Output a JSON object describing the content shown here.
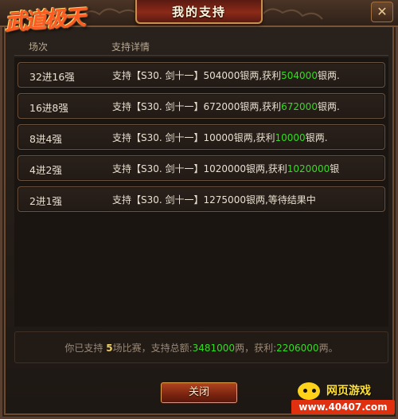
{
  "window": {
    "title": "我的支持",
    "logo_text": "武道极天",
    "close_x": "✕"
  },
  "table": {
    "header_round": "场次",
    "header_detail": "支持详情",
    "rows": [
      {
        "round": "32进16强",
        "prefix": "支持【S30. 剑十一】504000银两,获利",
        "amount": "504000",
        "suffix": "银两."
      },
      {
        "round": "16进8强",
        "prefix": "支持【S30. 剑十一】672000银两,获利",
        "amount": "672000",
        "suffix": "银两."
      },
      {
        "round": "8进4强",
        "prefix": "支持【S30. 剑十一】10000银两,获利",
        "amount": "10000",
        "suffix": "银两."
      },
      {
        "round": "4进2强",
        "prefix": "支持【S30. 剑十一】1020000银两,获利",
        "amount": "1020000",
        "suffix": "银"
      },
      {
        "round": "2进1强",
        "prefix": "支持【S30. 剑十一】1275000银两,等待结果中",
        "amount": "",
        "suffix": ""
      }
    ]
  },
  "summary": {
    "p1": "你已支持 ",
    "matches": "5",
    "p2": "场比赛，支持总额:",
    "total": "3481000",
    "p3": "两，获利:",
    "profit": "2206000",
    "p4": "两。"
  },
  "footer": {
    "close_label": "关闭"
  },
  "watermark": {
    "top": "网页游戏",
    "bottom": "www.40407.com"
  }
}
